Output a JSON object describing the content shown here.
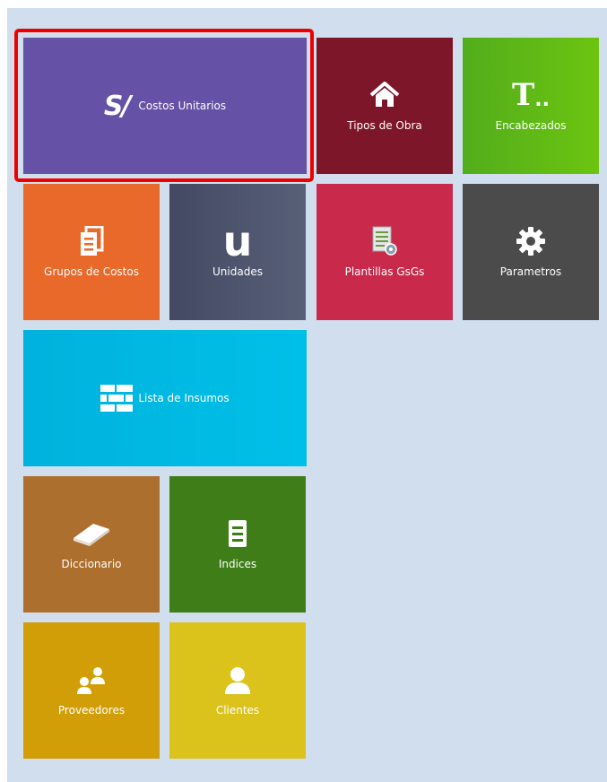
{
  "tiles": {
    "costos_unitarios": {
      "label": "Costos Unitarios",
      "icon": "sol-currency-icon",
      "glyph": "S/",
      "color": "#6551a6",
      "selected": true
    },
    "tipos_obra": {
      "label": "Tipos de Obra",
      "icon": "home-icon",
      "color": "#7d1628"
    },
    "encabezados": {
      "label": "Encabezados",
      "icon": "text-format-icon",
      "glyph": "T",
      "color": "#5fba1a"
    },
    "grupos_costos": {
      "label": "Grupos de Costos",
      "icon": "documents-icon",
      "color": "#e9692a"
    },
    "unidades": {
      "label": "Unidades",
      "icon": "unit-letter-icon",
      "glyph": "u",
      "color": "#4a5069"
    },
    "plantillas": {
      "label": "Plantillas GsGs",
      "icon": "template-settings-icon",
      "color": "#c9294b"
    },
    "parametros": {
      "label": "Parametros",
      "icon": "gear-icon",
      "color": "#4b4b4b"
    },
    "lista_insumos": {
      "label": "Lista de Insumos",
      "icon": "brick-wall-icon",
      "color": "#00b8e0"
    },
    "diccionario": {
      "label": "Diccionario",
      "icon": "book-icon",
      "color": "#ad6f2d"
    },
    "indices": {
      "label": "Indices",
      "icon": "document-lines-icon",
      "color": "#3e7d18"
    },
    "proveedores": {
      "label": "Proveedores",
      "icon": "users-icon",
      "color": "#d29e07"
    },
    "clientes": {
      "label": "Clientes",
      "icon": "user-icon",
      "color": "#dcc31c"
    }
  }
}
